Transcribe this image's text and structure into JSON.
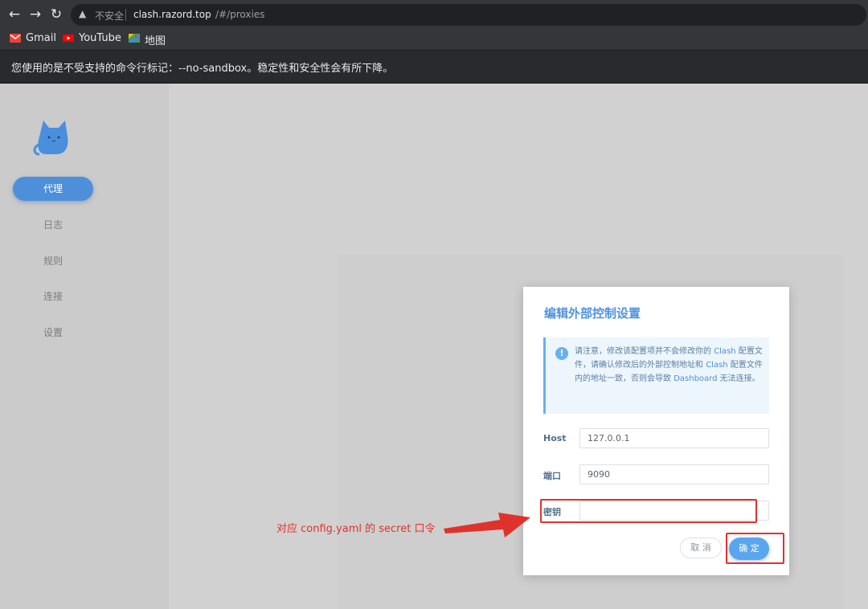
{
  "browser": {
    "security_label": "不安全",
    "url_host": "clash.razord.top",
    "url_path": "/#/proxies",
    "bookmarks": [
      {
        "label": "Gmail",
        "icon": "gmail-icon"
      },
      {
        "label": "YouTube",
        "icon": "youtube-icon"
      },
      {
        "label": "地图",
        "icon": "maps-icon"
      }
    ],
    "infobar_message": "您使用的是不受支持的命令行标记：--no-sandbox。稳定性和安全性会有所下降。"
  },
  "sidebar": {
    "items": [
      {
        "label": "代理",
        "active": true
      },
      {
        "label": "日志",
        "active": false
      },
      {
        "label": "规则",
        "active": false
      },
      {
        "label": "连接",
        "active": false
      },
      {
        "label": "设置",
        "active": false
      }
    ]
  },
  "modal": {
    "title": "编辑外部控制设置",
    "notice": {
      "p1": "请注意，修改该配置项并不会修改你的 ",
      "clash1": "Clash",
      "p2": " 配置文件，请确认修改后的外部控制地址和 ",
      "clash2": "Clash",
      "p3": " 配置文件内的地址一致，否则会导致 ",
      "dashboard": "Dashboard",
      "p4": " 无法连接。"
    },
    "fields": {
      "host_label": "Host",
      "host_value": "127.0.0.1",
      "port_label": "端口",
      "port_value": "9090",
      "secret_label": "密钥",
      "secret_value": ""
    },
    "cancel_label": "取 消",
    "ok_label": "确 定"
  },
  "annotation": {
    "text": "对应 config.yaml 的 secret 口令",
    "color": "#e0322c"
  },
  "colors": {
    "accent": "#4d8fd9",
    "title_blue": "#4f92e2",
    "annotation_red": "#e0322c"
  }
}
